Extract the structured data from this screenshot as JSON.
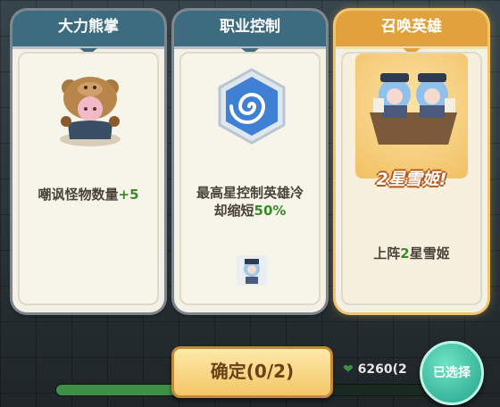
{
  "cards": [
    {
      "title": "大力熊掌",
      "desc_prefix": "嘲讽怪物数量",
      "desc_value": "+5",
      "icon": "bear-hero-portrait"
    },
    {
      "title": "职业控制",
      "desc_line1": "最高星控制英雄冷",
      "desc_line2_prefix": "却缩短",
      "desc_value": "50%",
      "icon": "swirl-hexagon-icon",
      "sub_icon": "snow-princess-mini-avatar"
    },
    {
      "title": "召唤英雄",
      "banner_text": "2星雪姬!",
      "desc_prefix": "上阵",
      "desc_value": "2",
      "desc_suffix": "星雪姬",
      "icon": "snow-princess-duo-portrait"
    }
  ],
  "confirm_label": "确定(0/2)",
  "selected_label": "已选择",
  "power_value": "6260(2",
  "progress_fraction": 0.47,
  "colors": {
    "accent_green": "#3a8a2a",
    "gold": "#e2a23b",
    "header_blue": "#3d6b80"
  }
}
